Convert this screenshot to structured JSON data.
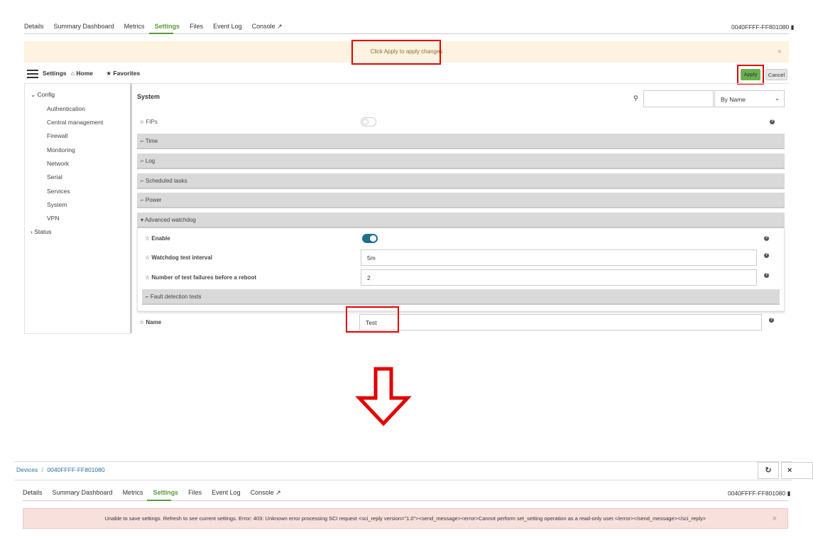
{
  "top": {
    "tabs": [
      "Details",
      "Summary Dashboard",
      "Metrics",
      "Settings",
      "Files",
      "Event Log",
      "Console"
    ],
    "device_id": "0040FFFF-FF801080",
    "hint_message": "Click Apply to apply changes",
    "close_glyph": "×",
    "toolbar": {
      "settings_label": "Settings",
      "home_label": "Home",
      "favorites_label": "Favorites",
      "apply_label": "Apply",
      "cancel_label": "Cancel"
    },
    "sidebar": {
      "config_label": "Config",
      "config_items": [
        "Authentication",
        "Central management",
        "Firewall",
        "Monitoring",
        "Network",
        "Serial",
        "Services",
        "System",
        "VPN"
      ],
      "status_label": "Status"
    },
    "main": {
      "section_title": "System",
      "search_value": "",
      "sort_select": "By Name",
      "fips_label": "FIPs",
      "fips_enabled": false,
      "sections": [
        "Time",
        "Log",
        "Scheduled tasks",
        "Power",
        "Advanced watchdog"
      ],
      "watchdog": {
        "enable_label": "Enable",
        "enable_value": true,
        "interval_label": "Watchdog test interval",
        "interval_value": "5m",
        "failures_label": "Number of test failures before a reboot",
        "failures_value": "2",
        "fault_tests_label": "Fault detection tests"
      },
      "name_label": "Name",
      "name_value": "Test"
    }
  },
  "bottom": {
    "breadcrumb_devices": "Devices",
    "breadcrumb_sep": "/",
    "breadcrumb_device": "0040FFFF-FF801080",
    "tabs": [
      "Details",
      "Summary Dashboard",
      "Metrics",
      "Settings",
      "Files",
      "Event Log",
      "Console"
    ],
    "device_id": "0040FFFF-FF801080",
    "error_message": "Unable to save settings. Refresh to see current settings. Error: 403: Unknown error processing SCI request <sci_reply version=\"1.0\"><send_message><error>Cannot perform set_setting operation as a read-only user.</error></send_message></sci_reply>"
  },
  "colors": {
    "accent": "#5a9a3c",
    "highlight": "#e00000",
    "toggle_on": "#1d6f8a",
    "error_bg": "#f8e0dc",
    "hint_bg": "#fdf3e0"
  }
}
